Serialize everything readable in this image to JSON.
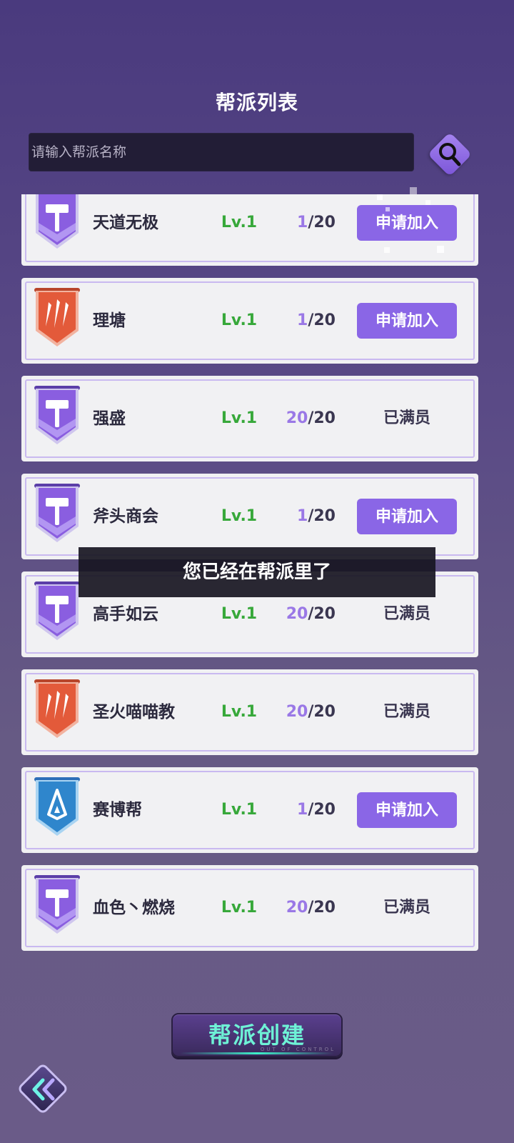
{
  "page": {
    "title": "帮派列表"
  },
  "search": {
    "placeholder": "请输入帮派名称"
  },
  "guilds": [
    {
      "emblem": "hammer",
      "name": "天道无极",
      "level": "Lv.1",
      "members": "1",
      "capacity": "/20",
      "status": "join",
      "action_label": "申请加入"
    },
    {
      "emblem": "claw",
      "name": "理塘",
      "level": "Lv.1",
      "members": "1",
      "capacity": "/20",
      "status": "join",
      "action_label": "申请加入"
    },
    {
      "emblem": "hammer",
      "name": "强盛",
      "level": "Lv.1",
      "members": "20",
      "capacity": "/20",
      "status": "full",
      "action_label": "已满员"
    },
    {
      "emblem": "hammer",
      "name": "斧头商会",
      "level": "Lv.1",
      "members": "1",
      "capacity": "/20",
      "status": "join",
      "action_label": "申请加入"
    },
    {
      "emblem": "hammer",
      "name": "高手如云",
      "level": "Lv.1",
      "members": "20",
      "capacity": "/20",
      "status": "full",
      "action_label": "已满员"
    },
    {
      "emblem": "claw",
      "name": "圣火喵喵教",
      "level": "Lv.1",
      "members": "20",
      "capacity": "/20",
      "status": "full",
      "action_label": "已满员"
    },
    {
      "emblem": "crystal",
      "name": "赛博帮",
      "level": "Lv.1",
      "members": "1",
      "capacity": "/20",
      "status": "join",
      "action_label": "申请加入"
    },
    {
      "emblem": "hammer",
      "name": "血色丶燃烧",
      "level": "Lv.1",
      "members": "20",
      "capacity": "/20",
      "status": "full",
      "action_label": "已满员"
    }
  ],
  "toast": {
    "message": "您已经在帮派里了"
  },
  "create_button": {
    "label": "帮派创建",
    "sub_label": "OUT OF CONTROL"
  },
  "back_button": {
    "icon": "double-chevron-left-icon"
  },
  "colors": {
    "accent_purple": "#8a66e6",
    "level_green": "#37a83a",
    "member_purple": "#9a78e6",
    "create_text_teal": "#6ef2d6"
  }
}
